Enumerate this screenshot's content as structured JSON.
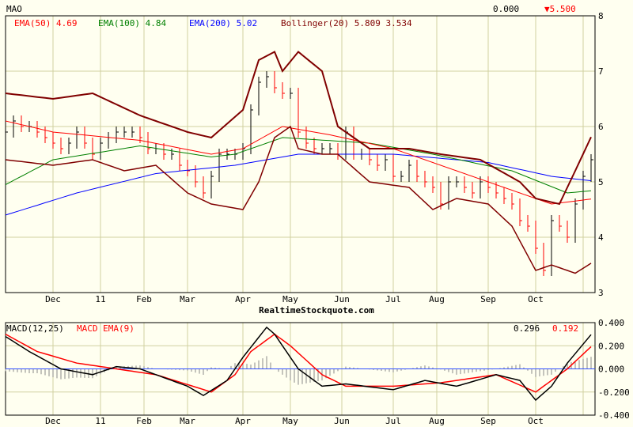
{
  "chart_data": [
    {
      "type": "line",
      "title": "MAO",
      "last": "0.000",
      "change": "▼5.500",
      "legend": [
        {
          "label": "EMA(50)",
          "value": "4.69",
          "color": "#ff0000"
        },
        {
          "label": "EMA(100)",
          "value": "4.84",
          "color": "#008000"
        },
        {
          "label": "EMA(200)",
          "value": "5.02",
          "color": "#0000ff"
        },
        {
          "label": "Bollinger(20)",
          "value": "5.809",
          "value2": "3.534",
          "color": "#800000"
        }
      ],
      "ylim": [
        3,
        8
      ],
      "yticks": [
        "3",
        "4",
        "5",
        "6",
        "7",
        "8"
      ],
      "xticks": [
        {
          "t": 6,
          "label": "Dec"
        },
        {
          "t": 12,
          "label": "11"
        },
        {
          "t": 17.5,
          "label": "Feb"
        },
        {
          "t": 23,
          "label": "Mar"
        },
        {
          "t": 30,
          "label": "Apr"
        },
        {
          "t": 36,
          "label": "May"
        },
        {
          "t": 42.5,
          "label": "Jun"
        },
        {
          "t": 49,
          "label": "Jul"
        },
        {
          "t": 54.5,
          "label": "Aug"
        },
        {
          "t": 61,
          "label": "Sep"
        },
        {
          "t": 67,
          "label": "Oct"
        },
        {
          "t": 73,
          "label": ""
        }
      ],
      "close": [
        5.9,
        6.1,
        6.0,
        6.0,
        5.9,
        5.8,
        5.7,
        5.6,
        5.7,
        5.9,
        5.7,
        5.5,
        5.7,
        5.8,
        5.9,
        5.9,
        5.9,
        5.8,
        5.6,
        5.6,
        5.5,
        5.5,
        5.3,
        5.2,
        5.0,
        4.8,
        5.1,
        5.5,
        5.5,
        5.5,
        5.6,
        6.3,
        6.8,
        6.9,
        6.7,
        6.6,
        6.6,
        5.9,
        5.7,
        5.6,
        5.6,
        5.6,
        5.5,
        5.9,
        5.5,
        5.5,
        5.4,
        5.3,
        5.4,
        5.1,
        5.1,
        5.3,
        5.1,
        5.0,
        4.9,
        4.6,
        5.0,
        5.0,
        4.9,
        4.8,
        5.0,
        4.9,
        4.8,
        4.7,
        4.6,
        4.3,
        4.2,
        3.8,
        3.4,
        4.3,
        4.2,
        4.0,
        4.6,
        5.1,
        5.4
      ],
      "ema50": [
        [
          0,
          6.1
        ],
        [
          6,
          5.9
        ],
        [
          17,
          5.75
        ],
        [
          26,
          5.5
        ],
        [
          30,
          5.6
        ],
        [
          35,
          6.0
        ],
        [
          41,
          5.85
        ],
        [
          49,
          5.6
        ],
        [
          55,
          5.3
        ],
        [
          61,
          5.0
        ],
        [
          69,
          4.6
        ],
        [
          74,
          4.69
        ]
      ],
      "ema100": [
        [
          0,
          4.95
        ],
        [
          6,
          5.4
        ],
        [
          17,
          5.65
        ],
        [
          26,
          5.45
        ],
        [
          29,
          5.5
        ],
        [
          35,
          5.8
        ],
        [
          46,
          5.7
        ],
        [
          54,
          5.5
        ],
        [
          64,
          5.2
        ],
        [
          71,
          4.8
        ],
        [
          74,
          4.84
        ]
      ],
      "ema200": [
        [
          0,
          4.4
        ],
        [
          9,
          4.8
        ],
        [
          19,
          5.15
        ],
        [
          29,
          5.3
        ],
        [
          37,
          5.5
        ],
        [
          49,
          5.5
        ],
        [
          61,
          5.35
        ],
        [
          69,
          5.1
        ],
        [
          74,
          5.02
        ]
      ],
      "boll_upper": [
        [
          0,
          6.6
        ],
        [
          6,
          6.5
        ],
        [
          11,
          6.6
        ],
        [
          17,
          6.2
        ],
        [
          23,
          5.9
        ],
        [
          26,
          5.8
        ],
        [
          30,
          6.3
        ],
        [
          32,
          7.2
        ],
        [
          34,
          7.35
        ],
        [
          35,
          7.0
        ],
        [
          37,
          7.35
        ],
        [
          40,
          7.0
        ],
        [
          42,
          6.0
        ],
        [
          46,
          5.6
        ],
        [
          51,
          5.6
        ],
        [
          55,
          5.5
        ],
        [
          60,
          5.4
        ],
        [
          65,
          5.0
        ],
        [
          67,
          4.7
        ],
        [
          70,
          4.6
        ],
        [
          72,
          5.2
        ],
        [
          74,
          5.81
        ]
      ],
      "boll_lower": [
        [
          0,
          5.4
        ],
        [
          6,
          5.3
        ],
        [
          11,
          5.4
        ],
        [
          15,
          5.2
        ],
        [
          19,
          5.3
        ],
        [
          23,
          4.8
        ],
        [
          26,
          4.6
        ],
        [
          30,
          4.5
        ],
        [
          32,
          5.0
        ],
        [
          34,
          5.8
        ],
        [
          36,
          6.0
        ],
        [
          37,
          5.6
        ],
        [
          40,
          5.5
        ],
        [
          42,
          5.5
        ],
        [
          46,
          5.0
        ],
        [
          51,
          4.9
        ],
        [
          54,
          4.5
        ],
        [
          57,
          4.7
        ],
        [
          61,
          4.6
        ],
        [
          64,
          4.2
        ],
        [
          67,
          3.4
        ],
        [
          69,
          3.5
        ],
        [
          72,
          3.35
        ],
        [
          74,
          3.53
        ]
      ]
    },
    {
      "type": "line",
      "title": "MACD(12,25)",
      "signal_label": "MACD EMA(9)",
      "macd_value": "0.296",
      "signal_value": "0.192",
      "ylim": [
        -0.4,
        0.4
      ],
      "yticks": [
        "-0.400",
        "-0.200",
        "0.000",
        "0.200",
        "0.400"
      ],
      "macd": [
        [
          0,
          0.28
        ],
        [
          3,
          0.15
        ],
        [
          7,
          0.0
        ],
        [
          11,
          -0.05
        ],
        [
          14,
          0.02
        ],
        [
          17,
          0.0
        ],
        [
          23,
          -0.15
        ],
        [
          25,
          -0.23
        ],
        [
          28,
          -0.1
        ],
        [
          30,
          0.1
        ],
        [
          33,
          0.36
        ],
        [
          34,
          0.3
        ],
        [
          37,
          0.0
        ],
        [
          40,
          -0.15
        ],
        [
          43,
          -0.13
        ],
        [
          49,
          -0.18
        ],
        [
          53,
          -0.1
        ],
        [
          57,
          -0.15
        ],
        [
          62,
          -0.05
        ],
        [
          65,
          -0.1
        ],
        [
          67,
          -0.27
        ],
        [
          69,
          -0.15
        ],
        [
          71,
          0.05
        ],
        [
          74,
          0.296
        ]
      ],
      "signal": [
        [
          0,
          0.3
        ],
        [
          4,
          0.15
        ],
        [
          9,
          0.05
        ],
        [
          14,
          0.0
        ],
        [
          19,
          -0.05
        ],
        [
          26,
          -0.2
        ],
        [
          29,
          -0.05
        ],
        [
          31,
          0.15
        ],
        [
          34,
          0.3
        ],
        [
          36,
          0.2
        ],
        [
          40,
          -0.05
        ],
        [
          43,
          -0.15
        ],
        [
          49,
          -0.15
        ],
        [
          55,
          -0.12
        ],
        [
          62,
          -0.05
        ],
        [
          67,
          -0.2
        ],
        [
          71,
          0.0
        ],
        [
          74,
          0.192
        ]
      ]
    }
  ],
  "footer": "RealtimeStockquote.com"
}
